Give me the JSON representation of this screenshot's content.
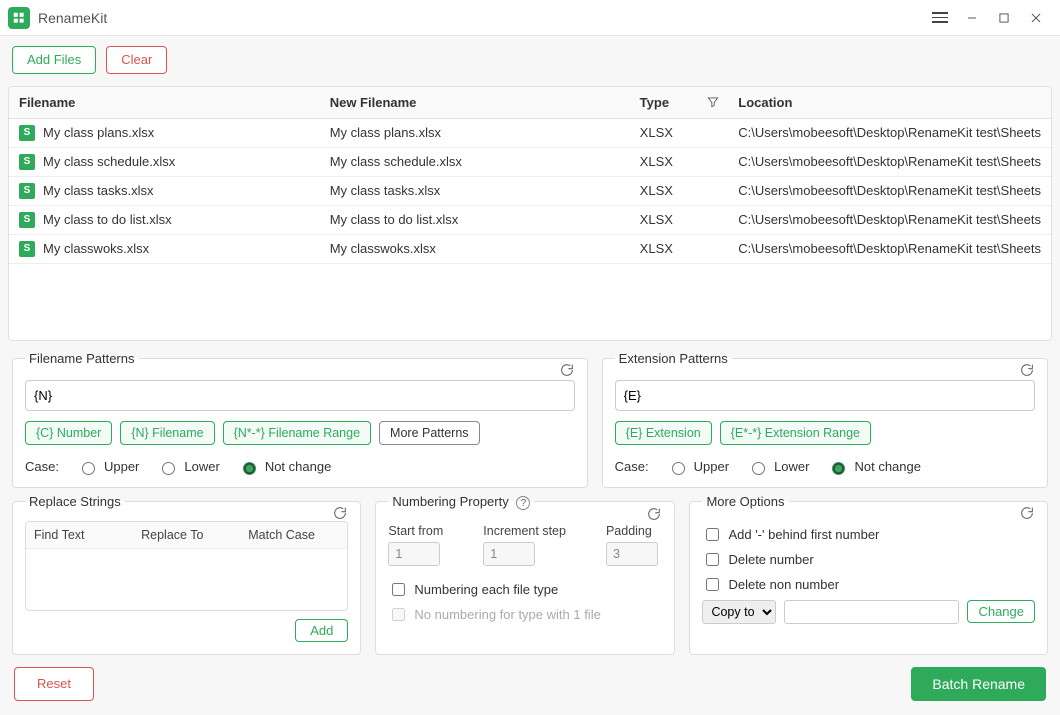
{
  "app": {
    "title": "RenameKit"
  },
  "toolbar": {
    "add_files": "Add Files",
    "clear": "Clear"
  },
  "table": {
    "columns": {
      "filename": "Filename",
      "new_filename": "New Filename",
      "type": "Type",
      "location": "Location"
    },
    "rows": [
      {
        "filename": "My class plans.xlsx",
        "new_filename": "My class plans.xlsx",
        "type": "XLSX",
        "location": "C:\\Users\\mobeesoft\\Desktop\\RenameKit test\\Sheets"
      },
      {
        "filename": "My class schedule.xlsx",
        "new_filename": "My class schedule.xlsx",
        "type": "XLSX",
        "location": "C:\\Users\\mobeesoft\\Desktop\\RenameKit test\\Sheets"
      },
      {
        "filename": "My class tasks.xlsx",
        "new_filename": "My class tasks.xlsx",
        "type": "XLSX",
        "location": "C:\\Users\\mobeesoft\\Desktop\\RenameKit test\\Sheets"
      },
      {
        "filename": "My class to do list.xlsx",
        "new_filename": "My class to do list.xlsx",
        "type": "XLSX",
        "location": "C:\\Users\\mobeesoft\\Desktop\\RenameKit test\\Sheets"
      },
      {
        "filename": "My classwoks.xlsx",
        "new_filename": "My classwoks.xlsx",
        "type": "XLSX",
        "location": "C:\\Users\\mobeesoft\\Desktop\\RenameKit test\\Sheets"
      }
    ]
  },
  "filename_patterns": {
    "legend": "Filename Patterns",
    "value": "{N}",
    "chips": {
      "number": "{C} Number",
      "filename": "{N} Filename",
      "range": "{N*-*} Filename Range",
      "more": "More Patterns"
    }
  },
  "extension_patterns": {
    "legend": "Extension Patterns",
    "value": "{E}",
    "chips": {
      "extension": "{E} Extension",
      "range": "{E*-*} Extension Range"
    }
  },
  "case_row": {
    "label": "Case:",
    "upper": "Upper",
    "lower": "Lower",
    "not_change": "Not change"
  },
  "replace": {
    "legend": "Replace Strings",
    "cols": {
      "find": "Find Text",
      "replace": "Replace To",
      "match": "Match Case"
    },
    "add": "Add"
  },
  "numbering": {
    "legend": "Numbering Property",
    "start_label": "Start from",
    "start_value": "1",
    "step_label": "Increment step",
    "step_value": "1",
    "pad_label": "Padding",
    "pad_value": "3",
    "each_type": "Numbering each file type",
    "no_num_single": "No numbering for type with 1 file"
  },
  "more": {
    "legend": "More Options",
    "add_dash": "Add '-' behind first number",
    "del_num": "Delete number",
    "del_nonnum": "Delete non number",
    "copy_to": "Copy to",
    "change": "Change"
  },
  "footer": {
    "reset": "Reset",
    "batch_rename": "Batch Rename"
  }
}
